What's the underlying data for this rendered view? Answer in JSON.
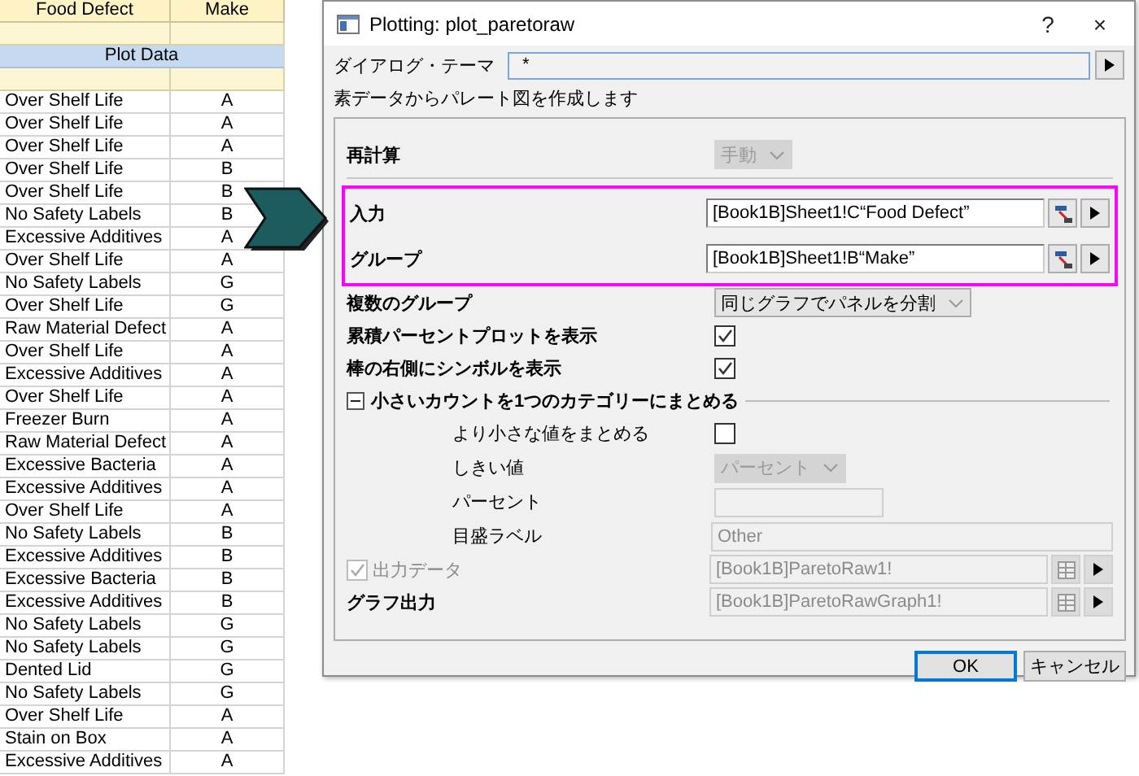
{
  "sheet": {
    "columns": [
      "Food Defect",
      "Make"
    ],
    "section_label": "Plot Data",
    "rows": [
      {
        "food_defect": "Over Shelf Life",
        "make": "A"
      },
      {
        "food_defect": "Over Shelf Life",
        "make": "A"
      },
      {
        "food_defect": "Over Shelf Life",
        "make": "A"
      },
      {
        "food_defect": "Over Shelf Life",
        "make": "B"
      },
      {
        "food_defect": "Over Shelf Life",
        "make": "B"
      },
      {
        "food_defect": "No Safety Labels",
        "make": "B"
      },
      {
        "food_defect": "Excessive Additives",
        "make": "A"
      },
      {
        "food_defect": "Over Shelf Life",
        "make": "A"
      },
      {
        "food_defect": "No Safety Labels",
        "make": "G"
      },
      {
        "food_defect": "Over Shelf Life",
        "make": "G"
      },
      {
        "food_defect": "Raw Material Defect",
        "make": "A"
      },
      {
        "food_defect": "Over Shelf Life",
        "make": "A"
      },
      {
        "food_defect": "Excessive Additives",
        "make": "A"
      },
      {
        "food_defect": "Over Shelf Life",
        "make": "A"
      },
      {
        "food_defect": "Freezer Burn",
        "make": "A"
      },
      {
        "food_defect": "Raw Material Defect",
        "make": "A"
      },
      {
        "food_defect": "Excessive Bacteria",
        "make": "A"
      },
      {
        "food_defect": "Excessive Additives",
        "make": "A"
      },
      {
        "food_defect": "Over Shelf Life",
        "make": "A"
      },
      {
        "food_defect": "No Safety Labels",
        "make": "B"
      },
      {
        "food_defect": "Excessive Additives",
        "make": "B"
      },
      {
        "food_defect": "Excessive Bacteria",
        "make": "B"
      },
      {
        "food_defect": "Excessive Additives",
        "make": "B"
      },
      {
        "food_defect": "No Safety Labels",
        "make": "G"
      },
      {
        "food_defect": "No Safety Labels",
        "make": "G"
      },
      {
        "food_defect": "Dented Lid",
        "make": "G"
      },
      {
        "food_defect": "No Safety Labels",
        "make": "G"
      },
      {
        "food_defect": "Over Shelf Life",
        "make": "A"
      },
      {
        "food_defect": "Stain on Box",
        "make": "A"
      },
      {
        "food_defect": "Excessive Additives",
        "make": "A"
      }
    ]
  },
  "dialog": {
    "title": "Plotting: plot_paretoraw",
    "help": "?",
    "close": "×",
    "theme": {
      "label": "ダイアログ・テーマ",
      "value": "*"
    },
    "description": "素データからパレート図を作成します",
    "options": [
      {
        "kind": "dropdown",
        "label": "再計算",
        "value": "手動",
        "disabled": true,
        "highlighted": false
      },
      {
        "kind": "range",
        "label": "入力",
        "value": "[Book1B]Sheet1!C“Food Defect”",
        "disabled": false,
        "highlighted": true
      },
      {
        "kind": "range",
        "label": "グループ",
        "value": "[Book1B]Sheet1!B“Make”",
        "disabled": false,
        "highlighted": true
      },
      {
        "kind": "dropdown",
        "label": "複数のグループ",
        "value": "同じグラフでパネルを分割",
        "disabled": false,
        "highlighted": false
      },
      {
        "kind": "checkbox",
        "label": "累積パーセントプロットを表示",
        "checked": true,
        "disabled": false,
        "highlighted": false
      },
      {
        "kind": "checkbox",
        "label": "棒の右側にシンボルを表示",
        "checked": true,
        "disabled": false,
        "highlighted": false
      },
      {
        "kind": "section",
        "label": "小さいカウントを1つのカテゴリーにまとめる",
        "expanded": true,
        "highlighted": false,
        "children": [
          {
            "kind": "checkbox",
            "label": "より小さな値をまとめる",
            "checked": false,
            "disabled": false
          },
          {
            "kind": "dropdown",
            "label": "しきい値",
            "value": "パーセント",
            "disabled": true
          },
          {
            "kind": "field",
            "label": "パーセント",
            "disabled": true
          },
          {
            "kind": "field",
            "label": "目盛ラベル",
            "value": "Other",
            "disabled": true
          }
        ]
      },
      {
        "kind": "range",
        "label": "出力データ",
        "checked": true,
        "value": "[Book1B]ParetoRaw1!",
        "disabled": true,
        "highlighted": false
      },
      {
        "kind": "range",
        "label": "グラフ出力",
        "value": "[Book1B]ParetoRawGraph1!",
        "disabled": true,
        "highlighted": false
      }
    ],
    "buttons": [
      {
        "label": "OK",
        "default": true
      },
      {
        "label": "キャンセル",
        "default": false
      }
    ]
  }
}
